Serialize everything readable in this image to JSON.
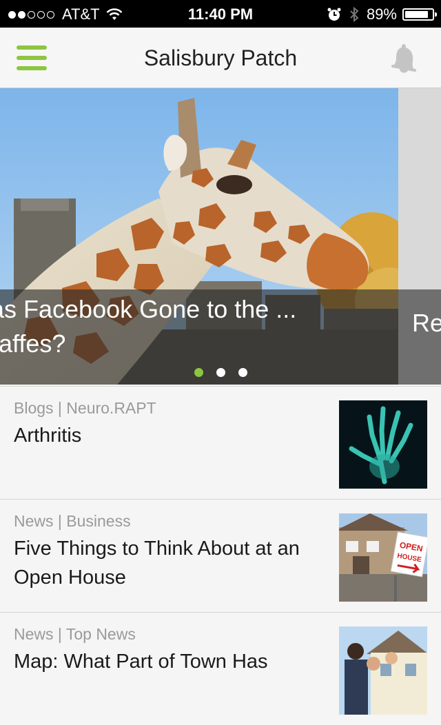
{
  "status_bar": {
    "carrier": "AT&T",
    "signal_bars": 2,
    "time": "11:40 PM",
    "battery_percent": "89%",
    "battery_level": 0.89
  },
  "nav": {
    "title": "Salisbury Patch",
    "menu_icon": "hamburger-icon",
    "notifications_icon": "bell-icon",
    "accent_color": "#8cc63f"
  },
  "hero": {
    "caption": "as Facebook Gone to the ...",
    "caption_line2": "raffes?",
    "next_caption": "Re",
    "page_count": 3,
    "active_page": 0
  },
  "articles": [
    {
      "category": "Blogs",
      "source": "Neuro.RAPT",
      "meta": "Blogs | Neuro.RAPT",
      "title": "Arthritis"
    },
    {
      "category": "News",
      "source": "Business",
      "meta": "News | Business",
      "title": "Five Things to Think About at an Open House"
    },
    {
      "category": "News",
      "source": "Top News",
      "meta": "News | Top News",
      "title": "Map: What Part of Town Has"
    }
  ],
  "open_house_sign": {
    "line1": "OPEN",
    "line2": "HOUSE"
  }
}
